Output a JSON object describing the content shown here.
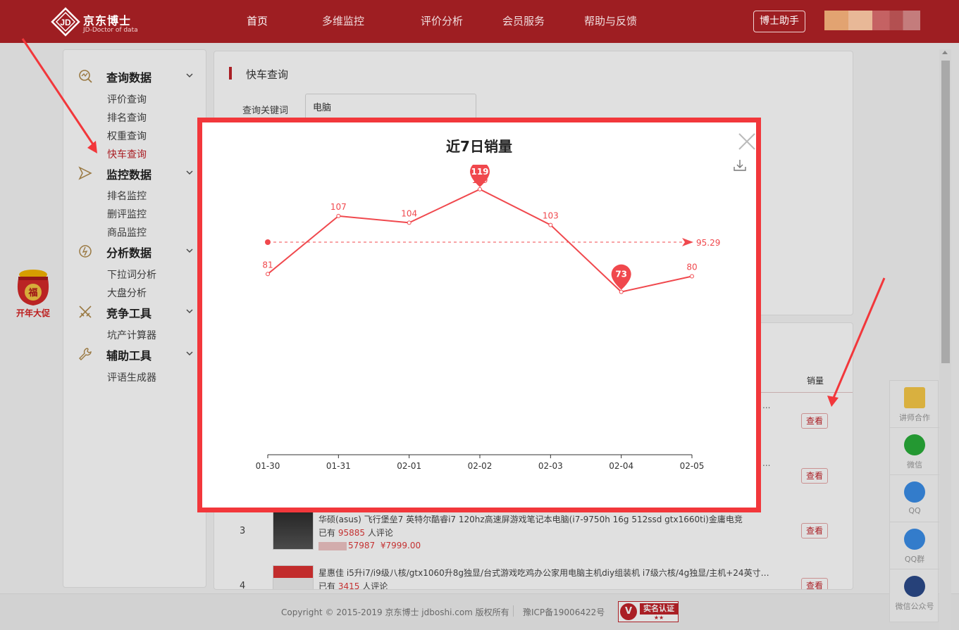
{
  "header": {
    "logo_title": "京东博士",
    "logo_subtitle": "JD-Doctor of data",
    "nav": [
      "首页",
      "多维监控",
      "评价分析",
      "会员服务",
      "帮助与反馈"
    ],
    "assistant_button": "博士助手"
  },
  "sidebar": {
    "groups": [
      {
        "label": "查询数据",
        "icon": "search-chart-icon",
        "items": [
          "评价查询",
          "排名查询",
          "权重查询",
          "快车查询"
        ]
      },
      {
        "label": "监控数据",
        "icon": "monitor-icon",
        "items": [
          "排名监控",
          "删评监控",
          "商品监控"
        ]
      },
      {
        "label": "分析数据",
        "icon": "analysis-icon",
        "items": [
          "下拉词分析",
          "大盘分析"
        ]
      },
      {
        "label": "竞争工具",
        "icon": "swords-icon",
        "items": [
          "坑产计算器"
        ]
      },
      {
        "label": "辅助工具",
        "icon": "wrench-icon",
        "items": [
          "评语生成器"
        ]
      }
    ],
    "active_item": "快车查询"
  },
  "promo": {
    "label": "开年大促",
    "badge": "福"
  },
  "query_panel": {
    "title": "快车查询",
    "keyword_label": "查询关键词",
    "keyword_value": "电脑"
  },
  "results": {
    "sales_header": "销量",
    "view_label": "查看",
    "rows": [
      {
        "index": "3",
        "title": "华硕(asus) 飞行堡垒7 英特尔酷睿i7 120hz高速屏游戏笔记本电脑(i7-9750h 16g 512ssd gtx1660ti)金庸电竞",
        "meta_prefix": "已有",
        "reviews": "95885",
        "meta_suffix": "人评论",
        "price_partial": "57987",
        "price": "¥7999.00"
      },
      {
        "index": "4",
        "title": "星惠佳 i5升i7/i9级八核/gtx1060升8g独显/台式游戏吃鸡办公家用电脑主机diy组装机 i7级六核/4g独显/主机+24英寸曲...",
        "meta_prefix": "已有",
        "reviews": "3415",
        "meta_suffix": "人评论"
      }
    ]
  },
  "footer": {
    "copyright": "Copyright © 2015-2019 京东博士 jdboshi.com 版权所有",
    "icp": "豫ICP备19006422号",
    "badge_text": "实名认证",
    "badge_v": "V",
    "badge_stars": "★★"
  },
  "float_bar": [
    {
      "label": "讲师合作",
      "icon": "lecturer-icon",
      "color": "#f7c948"
    },
    {
      "label": "微信",
      "icon": "wechat-icon",
      "color": "#2aae3a"
    },
    {
      "label": "QQ",
      "icon": "qq-icon",
      "color": "#3b8ee8"
    },
    {
      "label": "QQ群",
      "icon": "qq-group-icon",
      "color": "#3b8ee8"
    },
    {
      "label": "微信公众号",
      "icon": "wechat-official-icon",
      "color": "#2c4a8a"
    }
  ],
  "modal": {
    "title": "近7日销量"
  },
  "chart_data": {
    "type": "line",
    "title": "近7日销量",
    "categories": [
      "01-30",
      "01-31",
      "02-01",
      "02-02",
      "02-03",
      "02-04",
      "02-05"
    ],
    "series": [
      {
        "values": [
          81,
          107,
          104,
          119,
          103,
          73,
          80
        ]
      }
    ],
    "max_marker": 119,
    "min_marker": 73,
    "average_line": 95.29,
    "average_label": "95.29",
    "ylim": [
      0,
      130
    ],
    "line_color": "#f0484d",
    "grid": false
  }
}
